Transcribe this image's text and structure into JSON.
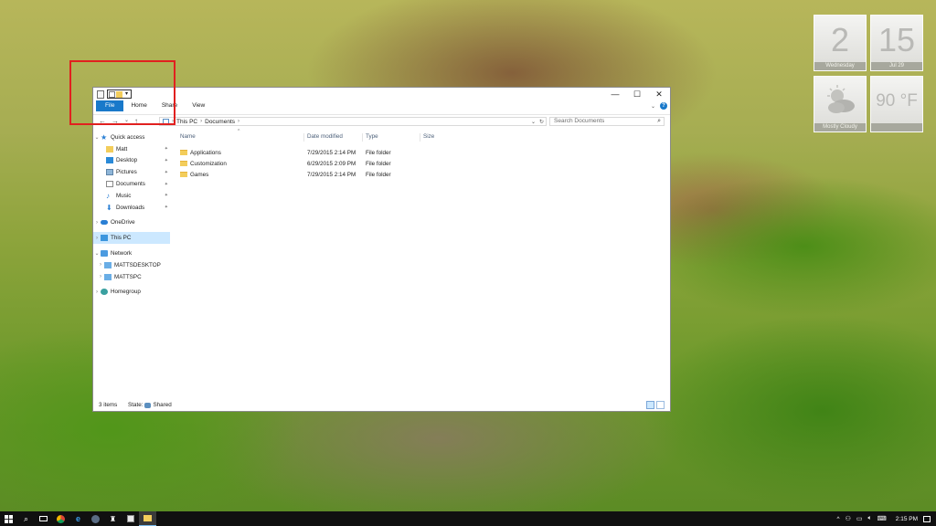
{
  "widgets": {
    "clock_hour": "2",
    "clock_minute": "15",
    "day": "Wednesday",
    "date": "Jul 29",
    "weather_temp": "90 °F",
    "weather_desc": "Mostly Cloudy"
  },
  "window": {
    "tabs": [
      "File",
      "Home",
      "Share",
      "View"
    ],
    "window_controls": {
      "minimize": "—",
      "maximize": "☐",
      "close": "✕"
    },
    "help": "?",
    "nav_buttons": [
      "←",
      "→",
      "⌄",
      "↑"
    ],
    "breadcrumb": [
      "This PC",
      "Documents"
    ],
    "search_placeholder": "Search Documents",
    "nav_pane": {
      "quick_access": "Quick access",
      "quick_items": [
        "Matt",
        "Desktop",
        "Pictures",
        "Documents",
        "Music",
        "Downloads"
      ],
      "onedrive": "OneDrive",
      "this_pc": "This PC",
      "network": "Network",
      "network_items": [
        "MATTSDESKTOP",
        "MATTSPC"
      ],
      "homegroup": "Homegroup"
    },
    "columns": [
      "Name",
      "Date modified",
      "Type",
      "Size"
    ],
    "files": [
      {
        "name": "Applications",
        "date": "7/29/2015 2:14 PM",
        "type": "File folder"
      },
      {
        "name": "Customization",
        "date": "6/29/2015 2:09 PM",
        "type": "File folder"
      },
      {
        "name": "Games",
        "date": "7/29/2015 2:14 PM",
        "type": "File folder"
      }
    ],
    "status": {
      "items": "3 items",
      "state_label": "State:",
      "state_value": "Shared"
    }
  },
  "taskbar": {
    "clock": "2:15 PM",
    "tray_chevron": "^"
  },
  "colors": {
    "accent": "#1979ca",
    "selection": "#cce8ff",
    "highlight_box": "#e1201f",
    "folder": "#f3cd5b",
    "taskbar": "#101010"
  }
}
